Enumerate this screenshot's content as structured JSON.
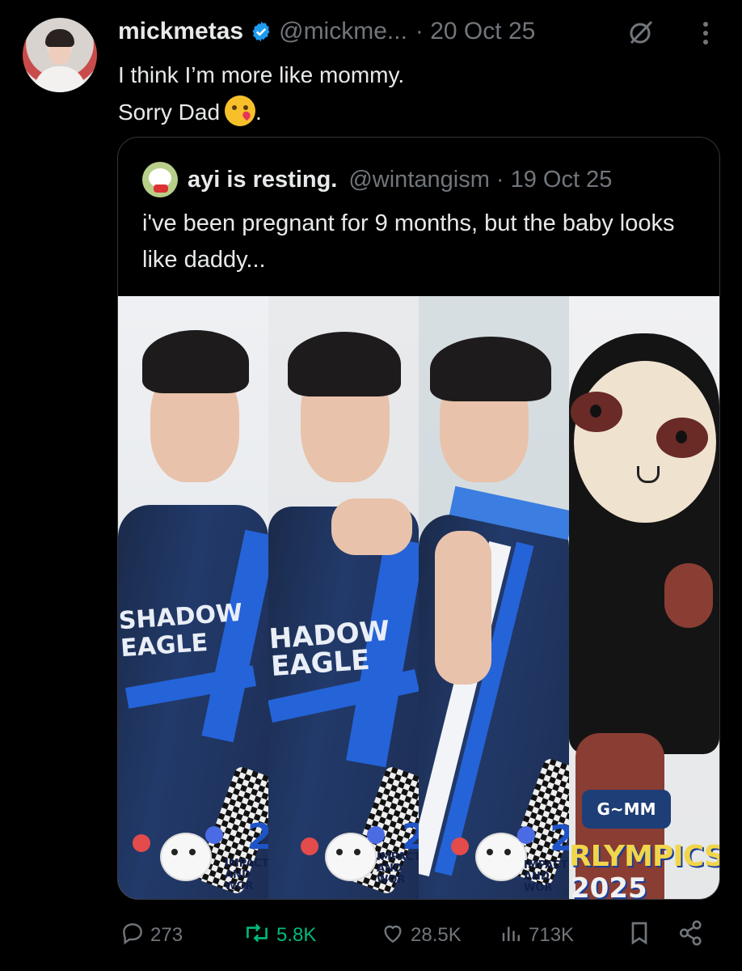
{
  "tweet": {
    "author_name": "mickmetas",
    "handle": "@mickme...",
    "date": "· 20 Oct 25",
    "text_line1": "I think I’m more like mommy.",
    "text_line2": "Sorry Dad",
    "text_suffix": "."
  },
  "quote": {
    "author_name": "ayi is resting.",
    "handle": "@wintangism",
    "date": "· 19 Oct 25",
    "text": "i've been pregnant for 9 months, but the baby looks like daddy..."
  },
  "images": {
    "panel1": {
      "jersey_line1": "SHADOW",
      "jersey_line2": "EAGLE",
      "badge_number": "2",
      "impact_line1": "IMPACT",
      "impact_line2": "AND WOR"
    },
    "panel2": {
      "jersey_line1": "HADOW",
      "jersey_line2": "EAGLE",
      "badge_number": "2",
      "impact_line1": "IMPACT",
      "impact_line2": "AND WOR"
    },
    "panel3": {
      "badge_number": "2",
      "impact_line1": "IMPACT",
      "impact_line2": "AND WOR"
    },
    "panel4": {
      "logo": "G~MM",
      "event": "RLYMPICS",
      "year": "2025"
    }
  },
  "actions": {
    "replies": "273",
    "reposts": "5.8K",
    "likes": "28.5K",
    "views": "713K"
  },
  "colors": {
    "background": "#000000",
    "text": "#e7e9ea",
    "muted": "#71767b",
    "verified": "#1d9bf0",
    "repost": "#00ba7c",
    "border": "#333639"
  },
  "icons": [
    "verified-badge-icon",
    "grok-icon",
    "more-icon",
    "reply-icon",
    "repost-icon",
    "like-icon",
    "views-icon",
    "bookmark-icon",
    "share-icon"
  ]
}
